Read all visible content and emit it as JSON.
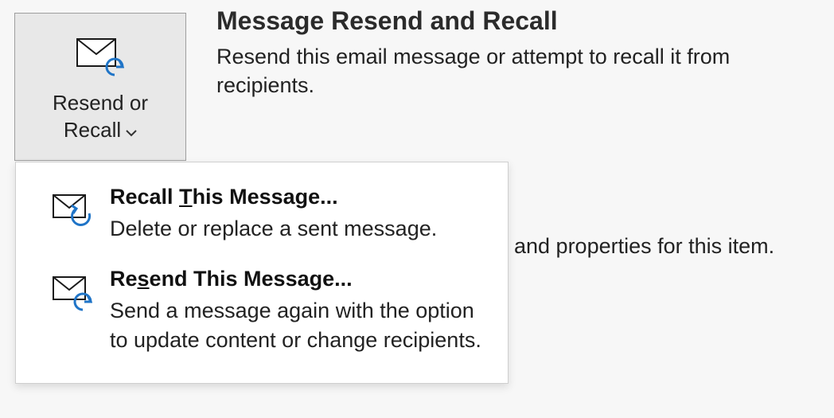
{
  "button": {
    "line1": "Resend or",
    "line2": "Recall"
  },
  "header": {
    "title": "Message Resend and Recall",
    "desc": "Resend this email message or attempt to recall it from recipients."
  },
  "background": {
    "partial_text": "and properties for this item."
  },
  "menu": {
    "recall": {
      "title_pre": "Recall ",
      "title_key": "T",
      "title_post": "his Message...",
      "desc": "Delete or replace a sent message."
    },
    "resend": {
      "title_pre": "Re",
      "title_key": "s",
      "title_post": "end This Message...",
      "desc": "Send a message again with the option to update content or change recipients."
    }
  }
}
